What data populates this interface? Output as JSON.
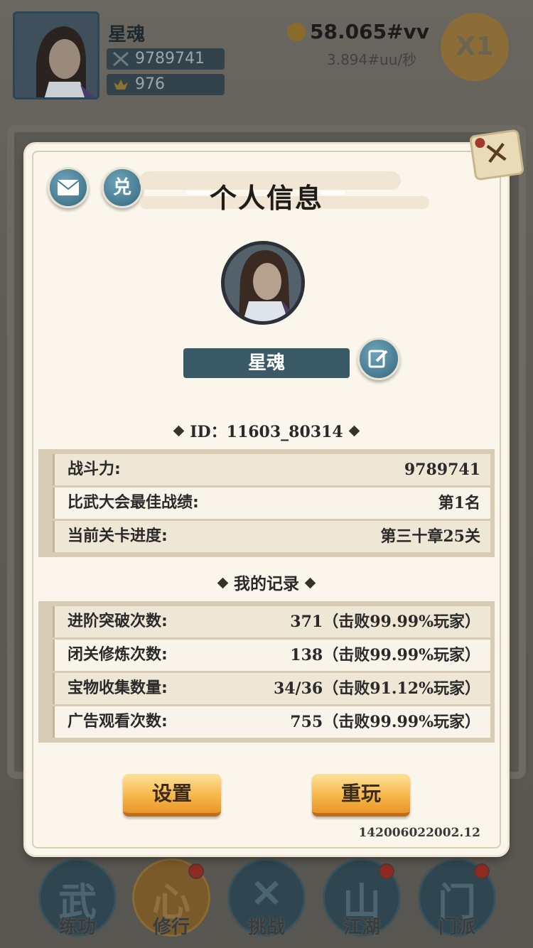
{
  "topbar": {
    "player_name": "星魂",
    "power": "9789741",
    "gold_ingot": "976",
    "coins": "58.065#vv",
    "rate": "3.894#uu/秒",
    "speed_label": "X1"
  },
  "modal": {
    "title": "个人信息",
    "mail_icon": "envelope-icon",
    "redeem_label": "兑",
    "close_label": "✕",
    "nickname": "星魂",
    "player_id": "ID：11603_80314",
    "profile_rows": [
      {
        "label": "战斗力:",
        "value": "9789741"
      },
      {
        "label": "比武大会最佳战绩:",
        "value": "第1名"
      },
      {
        "label": "当前关卡进度:",
        "value": "第三十章25关"
      }
    ],
    "records_title": "我的记录",
    "record_rows": [
      {
        "label": "进阶突破次数:",
        "value": "371（击败99.99%玩家）"
      },
      {
        "label": "闭关修炼次数:",
        "value": "138（击败99.99%玩家）"
      },
      {
        "label": "宝物收集数量:",
        "value": "34/36（击败91.12%玩家）"
      },
      {
        "label": "广告观看次数:",
        "value": "755（击败99.99%玩家）"
      }
    ],
    "settings_label": "设置",
    "replay_label": "重玩",
    "version": "142006022002.12"
  },
  "bottom_nav": [
    {
      "label": "练功",
      "glyph": "武",
      "badge": false
    },
    {
      "label": "修行",
      "glyph": "心",
      "badge": true
    },
    {
      "label": "挑战",
      "glyph": "✕",
      "badge": false
    },
    {
      "label": "江湖",
      "glyph": "山",
      "badge": true
    },
    {
      "label": "门派",
      "glyph": "门",
      "badge": true
    }
  ],
  "colors": {
    "panel_bg": "#fbf6ec",
    "accent_blue": "#467a91",
    "button_gold": "#f7b94a",
    "badge_red": "#8d2a22"
  }
}
